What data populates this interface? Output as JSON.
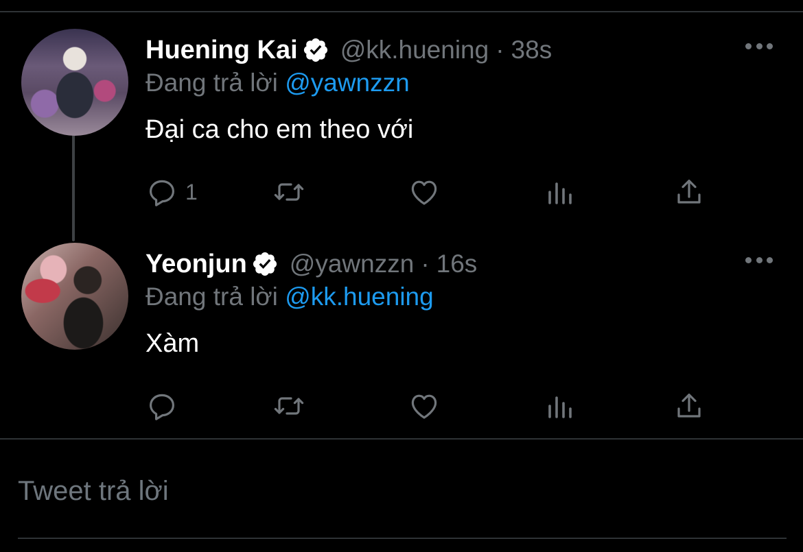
{
  "colors": {
    "background": "#000000",
    "divider": "#2f3336",
    "text_primary": "#ffffff",
    "text_secondary": "#71767b",
    "mention": "#1d9bf0"
  },
  "reply_prefix": "Đang trả lời",
  "tweets": [
    {
      "name": "Huening Kai",
      "verified": true,
      "handle": "@kk.huening",
      "separator": "·",
      "time": "38s",
      "reply_to": "@yawnzzn",
      "text": "Đại ca cho em theo với",
      "reply_count": "1",
      "icons": [
        "reply-icon",
        "retweet-icon",
        "like-icon",
        "views-icon",
        "share-icon",
        "more-icon"
      ]
    },
    {
      "name": "Yeonjun",
      "verified": true,
      "handle": "@yawnzzn",
      "separator": "·",
      "time": "16s",
      "reply_to": "@kk.huening",
      "text": "Xàm",
      "reply_count": "",
      "icons": [
        "reply-icon",
        "retweet-icon",
        "like-icon",
        "views-icon",
        "share-icon",
        "more-icon"
      ]
    }
  ],
  "composer": {
    "placeholder": "Tweet trả lời",
    "value": ""
  }
}
